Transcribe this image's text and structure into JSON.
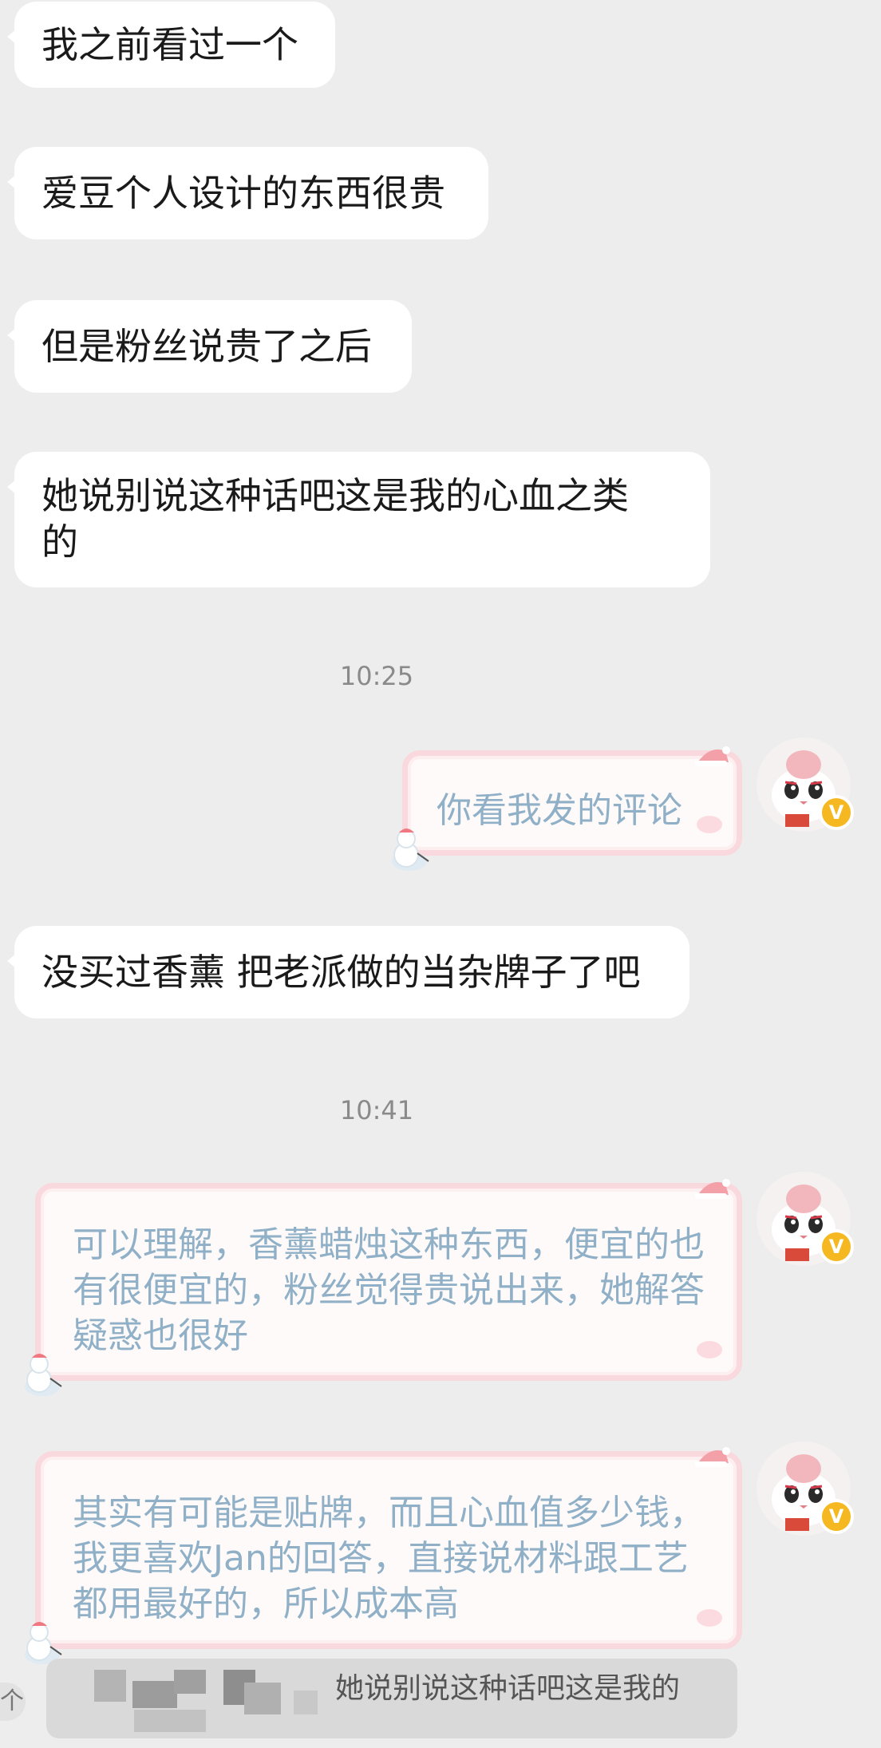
{
  "messages_in": [
    {
      "text": "我之前看过一个"
    },
    {
      "text": "爱豆个人设计的东西很贵"
    },
    {
      "text": "但是粉丝说贵了之后"
    },
    {
      "text": "她说别说这种话吧这是我的心血之类的"
    },
    {
      "text": "没买过香薰 把老派做的当杂牌子了吧"
    }
  ],
  "timestamps": [
    "10:25",
    "10:41"
  ],
  "messages_out": [
    {
      "text": "你看我发的评论"
    },
    {
      "text": "可以理解，香薰蜡烛这种东西，便宜的也有很便宜的，粉丝觉得贵说出来，她解答疑惑也很好"
    },
    {
      "text": "其实有可能是贴牌，而且心血值多少钱，我更喜欢Jan的回答，直接说材料跟工艺都用最好的，所以成本高"
    }
  ],
  "avatar": {
    "badge": "V",
    "icon": "cat-avatar-icon"
  },
  "quote_bar": {
    "text": "她说别说这种话吧这是我的",
    "icon": "up-arrow-icon",
    "icon_glyph": "个"
  },
  "colors": {
    "background": "#ededed",
    "incoming_bubble": "#ffffff",
    "outgoing_text": "#8fb0c7",
    "outgoing_border": "#f9d9dd",
    "badge": "#f5b820"
  }
}
